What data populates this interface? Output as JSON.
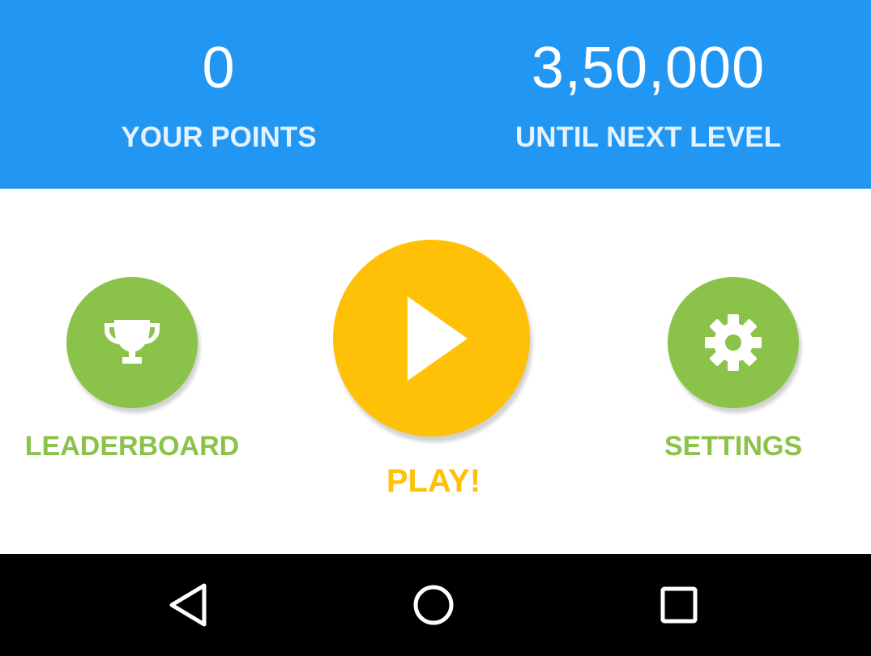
{
  "stats": {
    "points_value": "0",
    "points_label": "YOUR POINTS",
    "next_level_value": "3,50,000",
    "next_level_label": "UNTIL NEXT LEVEL"
  },
  "actions": {
    "leaderboard_label": "LEADERBOARD",
    "leaderboard_icon": "trophy-icon",
    "play_label": "PLAY!",
    "play_icon": "play-icon",
    "settings_label": "SETTINGS",
    "settings_icon": "gear-icon"
  },
  "navbar": {
    "back_icon": "back-icon",
    "home_icon": "home-icon",
    "recents_icon": "recents-icon"
  },
  "colors": {
    "header_blue": "#2196f3",
    "green": "#8bc34a",
    "amber": "#ffc107",
    "navbar": "#000000"
  }
}
